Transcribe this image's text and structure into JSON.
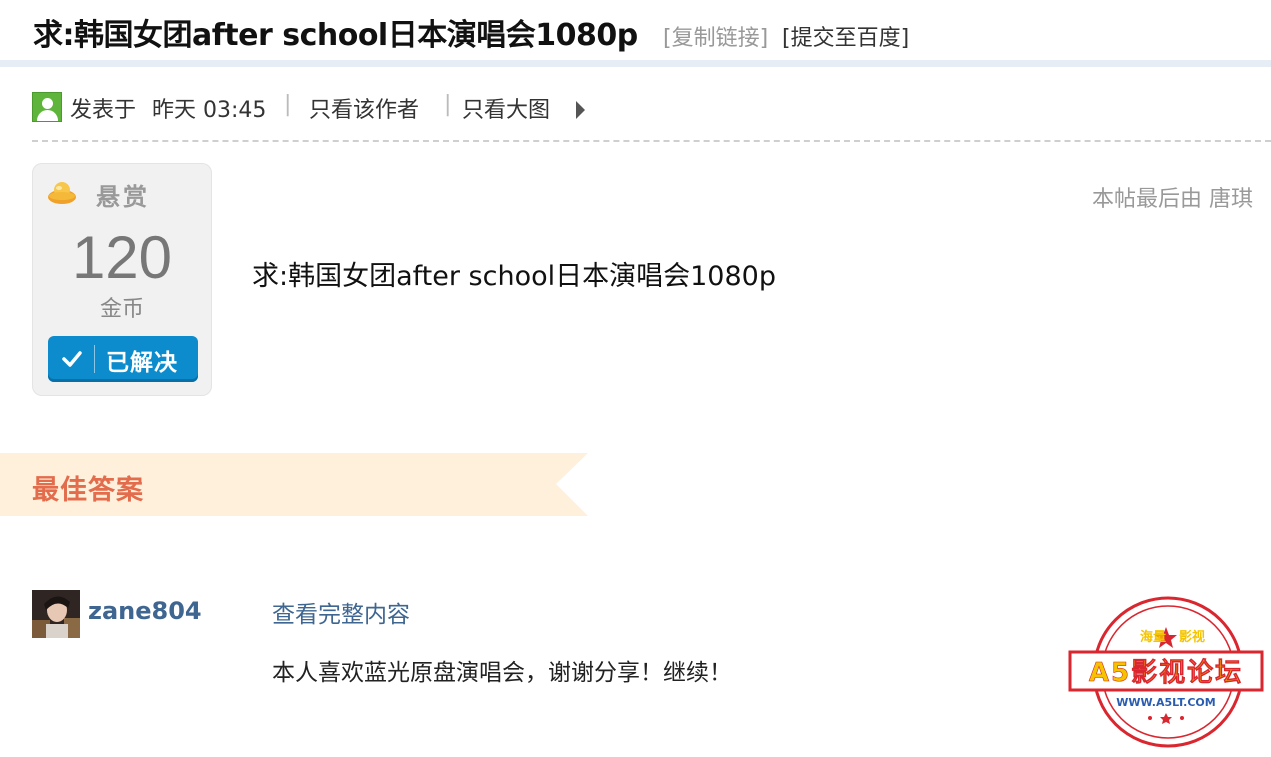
{
  "thread": {
    "title": "求:韩国女团after school日本演唱会1080p",
    "copy_link": "[复制链接]",
    "submit_baidu": "[提交至百度]"
  },
  "meta": {
    "posted_label": "发表于",
    "posted_time": "昨天 03:45",
    "separator": "|",
    "only_author": "只看该作者",
    "only_images": "只看大图"
  },
  "reward": {
    "label": "悬赏",
    "amount": "120",
    "unit": "金币",
    "status": "已解决"
  },
  "edit_note": "本帖最后由 唐琪",
  "post": {
    "body": "求:韩国女团after school日本演唱会1080p"
  },
  "best_answer": {
    "heading": "最佳答案",
    "username": "zane804",
    "view_full": "查看完整内容",
    "content": "本人喜欢蓝光原盘演唱会，谢谢分享！继续！"
  },
  "watermark": {
    "top_left": "海量",
    "top_right": "影视",
    "title": "A5影视论坛",
    "url": "WWW.A5LT.COM"
  },
  "colors": {
    "link_blue": "#3e6690",
    "accent_orange": "#e26c4c",
    "banner_bg": "#fff0db",
    "badge_blue": "#0c8ccc",
    "stamp_red": "#d9262f",
    "stamp_yellow": "#f5c400"
  },
  "icons": {
    "user": "user-icon",
    "expand": "arrow-right-icon",
    "reward": "gold-ingot-icon",
    "solved": "check-icon"
  }
}
